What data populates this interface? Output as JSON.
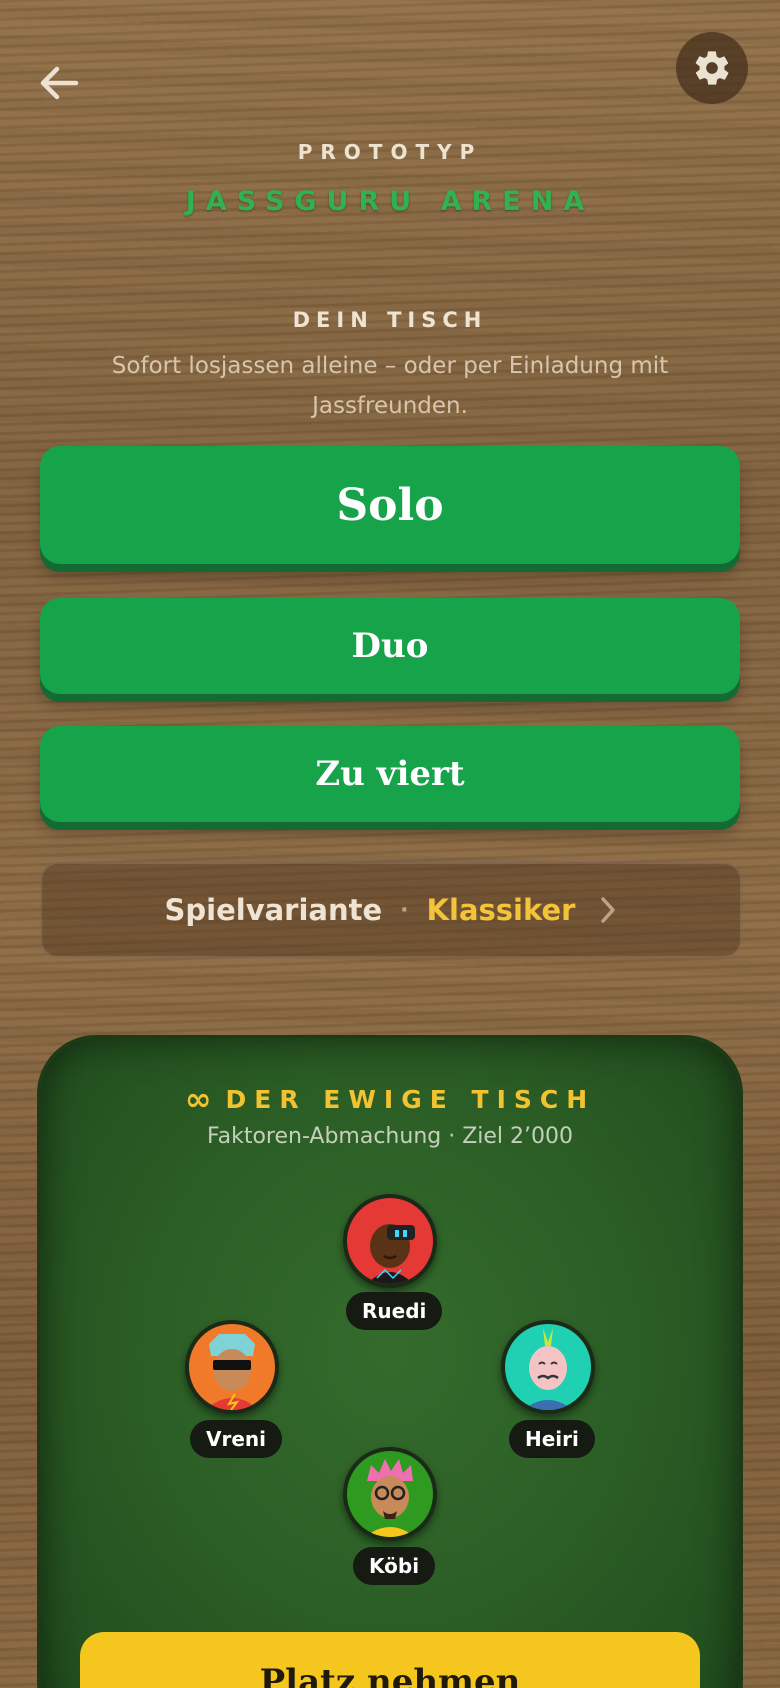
{
  "header": {
    "kicker": "PROTOTYP",
    "brand": "JASSGURU ARENA"
  },
  "icons": {
    "back": "arrow-left-icon",
    "settings": "gear-icon",
    "variant_chevron": "chevron-right-icon",
    "infinity": "infinity-icon"
  },
  "table_section": {
    "title": "DEIN TISCH",
    "subtitle": "Sofort losjassen alleine – oder per Einladung mit Jassfreunden."
  },
  "modes": {
    "solo": "Solo",
    "duo": "Duo",
    "four": "Zu viert"
  },
  "variant": {
    "label": "Spielvariante",
    "separator": "·",
    "value": "Klassiker"
  },
  "eternal_table": {
    "symbol": "∞",
    "title": "DER EWIGE TISCH",
    "subtitle": "Faktoren-Abmachung · Ziel 2’000",
    "players": [
      {
        "name": "Ruedi",
        "color": "#e53935"
      },
      {
        "name": "Vreni",
        "color": "#f07a2a"
      },
      {
        "name": "Heiri",
        "color": "#1fd0b3"
      },
      {
        "name": "Köbi",
        "color": "#2e9a1f"
      }
    ],
    "cta": "Platz nehmen"
  },
  "colors": {
    "primary_green": "#17a34a",
    "accent_yellow": "#f4c61e",
    "felt": "#2c5f26"
  }
}
